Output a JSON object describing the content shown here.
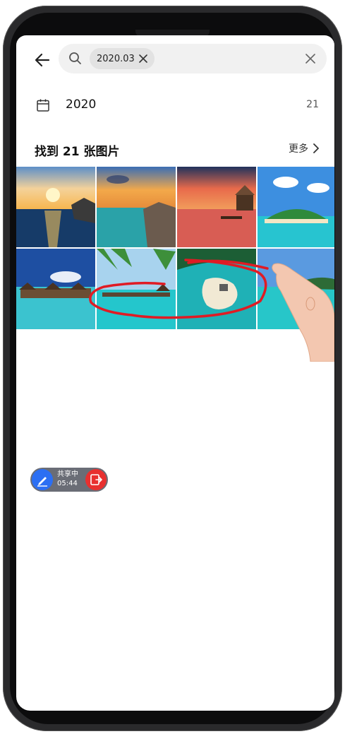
{
  "search": {
    "chip_text": "2020.03"
  },
  "date_row": {
    "label": "2020",
    "count": "21"
  },
  "results": {
    "title": "找到 21 张图片",
    "more_label": "更多"
  },
  "share": {
    "status": "共享中",
    "timer": "05:44"
  },
  "colors": {
    "pen": "#e01b24",
    "share_bg": "#6a6d76",
    "share_pen": "#2c6ff3",
    "share_exit": "#e8302f"
  },
  "icons": [
    "back-arrow-icon",
    "search-icon",
    "close-icon",
    "calendar-icon",
    "chevron-right-icon",
    "pen-icon",
    "exit-icon"
  ]
}
